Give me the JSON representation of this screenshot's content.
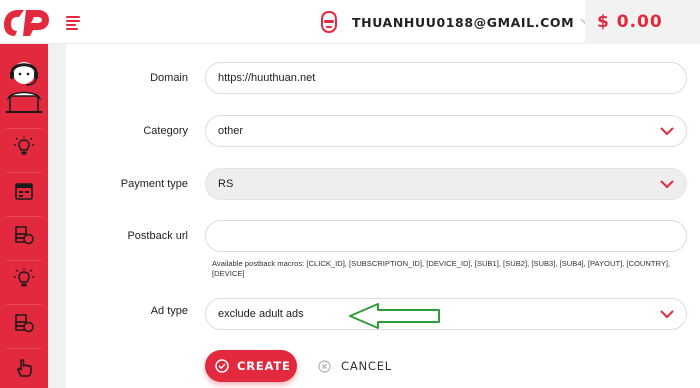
{
  "header": {
    "account_email": "THUANHUU0188@GMAIL.COM",
    "balance": "$ 0.00"
  },
  "sidebar": {
    "items": [
      {
        "icon": "avatar-icon"
      },
      {
        "icon": "lightbulb-icon"
      },
      {
        "icon": "calendar-icon"
      },
      {
        "icon": "coins-icon"
      },
      {
        "icon": "lightbulb-icon"
      },
      {
        "icon": "coins-icon"
      },
      {
        "icon": "hand-pointer-icon"
      }
    ]
  },
  "form": {
    "domain": {
      "label": "Domain",
      "value": "https://huuthuan.net"
    },
    "category": {
      "label": "Category",
      "value": "other"
    },
    "payment_type": {
      "label": "Payment type",
      "value": "RS"
    },
    "postback_url": {
      "label": "Postback url",
      "value": "",
      "hint": "Available postback macros: [CLICK_ID], [SUBSCRIPTION_ID], [DEVICE_ID], [SUB1], [SUB2], [SUB3], [SUB4], [PAYOUT], [COUNTRY], [DEVICE]"
    },
    "ad_type": {
      "label": "Ad type",
      "value": "exclude adult ads"
    }
  },
  "actions": {
    "create_label": "CREATE",
    "cancel_label": "CANCEL"
  },
  "colors": {
    "accent": "#e2293d",
    "annotation_arrow": "#2e9e3a"
  }
}
